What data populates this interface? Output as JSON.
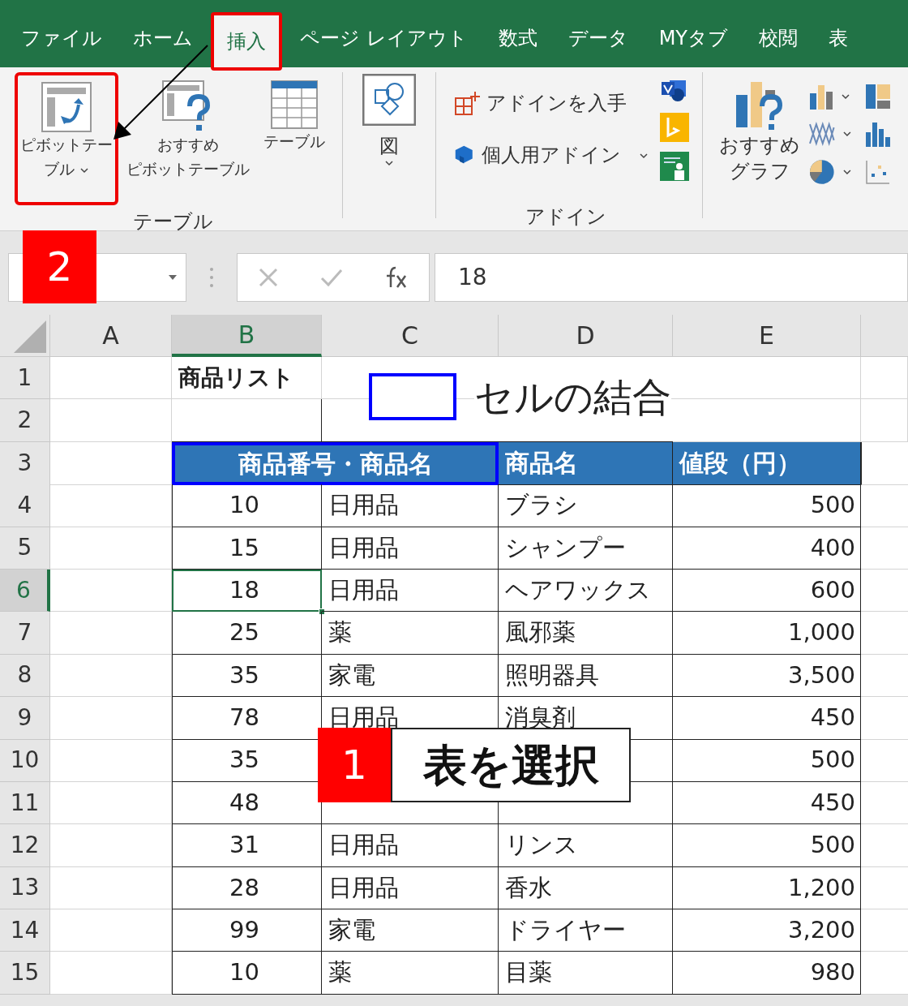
{
  "ribbon_tabs": [
    {
      "label": "ファイル",
      "selected": false
    },
    {
      "label": "ホーム",
      "selected": false
    },
    {
      "label": "挿入",
      "selected": true
    },
    {
      "label": "ページ レイアウト",
      "selected": false
    },
    {
      "label": "数式",
      "selected": false
    },
    {
      "label": "データ",
      "selected": false
    },
    {
      "label": "MYタブ",
      "selected": false
    },
    {
      "label": "校閲",
      "selected": false
    },
    {
      "label": "表",
      "selected": false
    }
  ],
  "ribbon": {
    "pivot_table": [
      "ピボットテー",
      "ブル"
    ],
    "recommended_pivot": [
      "おすすめ",
      "ピボットテーブル"
    ],
    "table": "テーブル",
    "table_group_label": "テーブル",
    "illustrations": "図",
    "get_addins": "アドインを入手",
    "my_addins": "個人用アドイン",
    "addins_group_label": "アドイン",
    "recommended_charts": [
      "おすすめ",
      "グラフ"
    ]
  },
  "formula_bar": {
    "value": "18"
  },
  "columns": [
    {
      "label": "A",
      "selected": false
    },
    {
      "label": "B",
      "selected": true
    },
    {
      "label": "C",
      "selected": false
    },
    {
      "label": "D",
      "selected": false
    },
    {
      "label": "E",
      "selected": false
    }
  ],
  "title_cell": "商品リスト",
  "header_row": {
    "merged": "商品番号・商品名",
    "name": "商品名",
    "price": "値段（円）"
  },
  "rows": [
    {
      "label": "1",
      "selected": false
    },
    {
      "label": "2",
      "selected": false
    },
    {
      "label": "3",
      "selected": false
    },
    {
      "label": "4",
      "selected": false,
      "active": false,
      "cells": [
        "10",
        "日用品",
        "ブラシ",
        "500"
      ]
    },
    {
      "label": "5",
      "selected": false,
      "active": false,
      "cells": [
        "15",
        "日用品",
        "シャンプー",
        "400"
      ]
    },
    {
      "label": "6",
      "selected": true,
      "active": true,
      "cells": [
        "18",
        "日用品",
        "ヘアワックス",
        "600"
      ]
    },
    {
      "label": "7",
      "selected": false,
      "active": false,
      "cells": [
        "25",
        "薬",
        "風邪薬",
        "1,000"
      ]
    },
    {
      "label": "8",
      "selected": false,
      "active": false,
      "cells": [
        "35",
        "家電",
        "照明器具",
        "3,500"
      ]
    },
    {
      "label": "9",
      "selected": false,
      "active": false,
      "cells": [
        "78",
        "日用品",
        "消臭剤",
        "450"
      ]
    },
    {
      "label": "10",
      "selected": false,
      "active": false,
      "cells": [
        "35",
        null,
        null,
        "500"
      ]
    },
    {
      "label": "11",
      "selected": false,
      "active": false,
      "cells": [
        "48",
        null,
        null,
        "450"
      ]
    },
    {
      "label": "12",
      "selected": false,
      "active": false,
      "cells": [
        "31",
        "日用品",
        "リンス",
        "500"
      ]
    },
    {
      "label": "13",
      "selected": false,
      "active": false,
      "cells": [
        "28",
        "日用品",
        "香水",
        "1,200"
      ]
    },
    {
      "label": "14",
      "selected": false,
      "active": false,
      "cells": [
        "99",
        "家電",
        "ドライヤー",
        "3,200"
      ]
    },
    {
      "label": "15",
      "selected": false,
      "active": false,
      "cells": [
        "10",
        "薬",
        "目薬",
        "980"
      ]
    }
  ],
  "legend": {
    "text": "セルの結合"
  },
  "annotations": {
    "step_2": "2",
    "step_1_number": "1",
    "step_1_text": "表を選択"
  }
}
